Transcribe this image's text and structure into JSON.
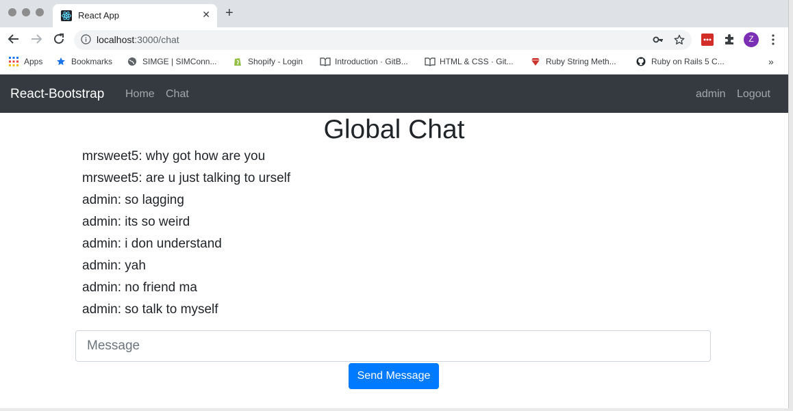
{
  "browser": {
    "tab_title": "React App",
    "url_host": "localhost",
    "url_rest": ":3000/chat",
    "profile_initial": "Z",
    "bookmarks": [
      {
        "label": "Apps",
        "icon": "apps-grid-icon"
      },
      {
        "label": "Bookmarks",
        "icon": "star-icon"
      },
      {
        "label": "SIMGE | SIMConn...",
        "icon": "globe-icon"
      },
      {
        "label": "Shopify - Login",
        "icon": "shopify-icon"
      },
      {
        "label": "Introduction · GitB...",
        "icon": "book-icon"
      },
      {
        "label": "HTML & CSS · Git...",
        "icon": "book-icon"
      },
      {
        "label": "Ruby String Meth...",
        "icon": "ruby-icon"
      },
      {
        "label": "Ruby on Rails 5 C...",
        "icon": "github-icon"
      }
    ],
    "overflow": "»"
  },
  "navbar": {
    "brand": "React-Bootstrap",
    "links": [
      "Home",
      "Chat"
    ],
    "user": "admin",
    "logout": "Logout"
  },
  "chat": {
    "title": "Global Chat",
    "messages": [
      "mrsweet5: why got how are you",
      "mrsweet5: are u just talking to urself",
      "admin: so lagging",
      "admin: its so weird",
      "admin: i don understand",
      "admin: yah",
      "admin: no friend ma",
      "admin: so talk to myself"
    ],
    "input_placeholder": "Message",
    "send_label": "Send Message"
  },
  "colors": {
    "navbar_bg": "#343a40",
    "primary": "#007bff",
    "profile": "#7b2fb5"
  }
}
